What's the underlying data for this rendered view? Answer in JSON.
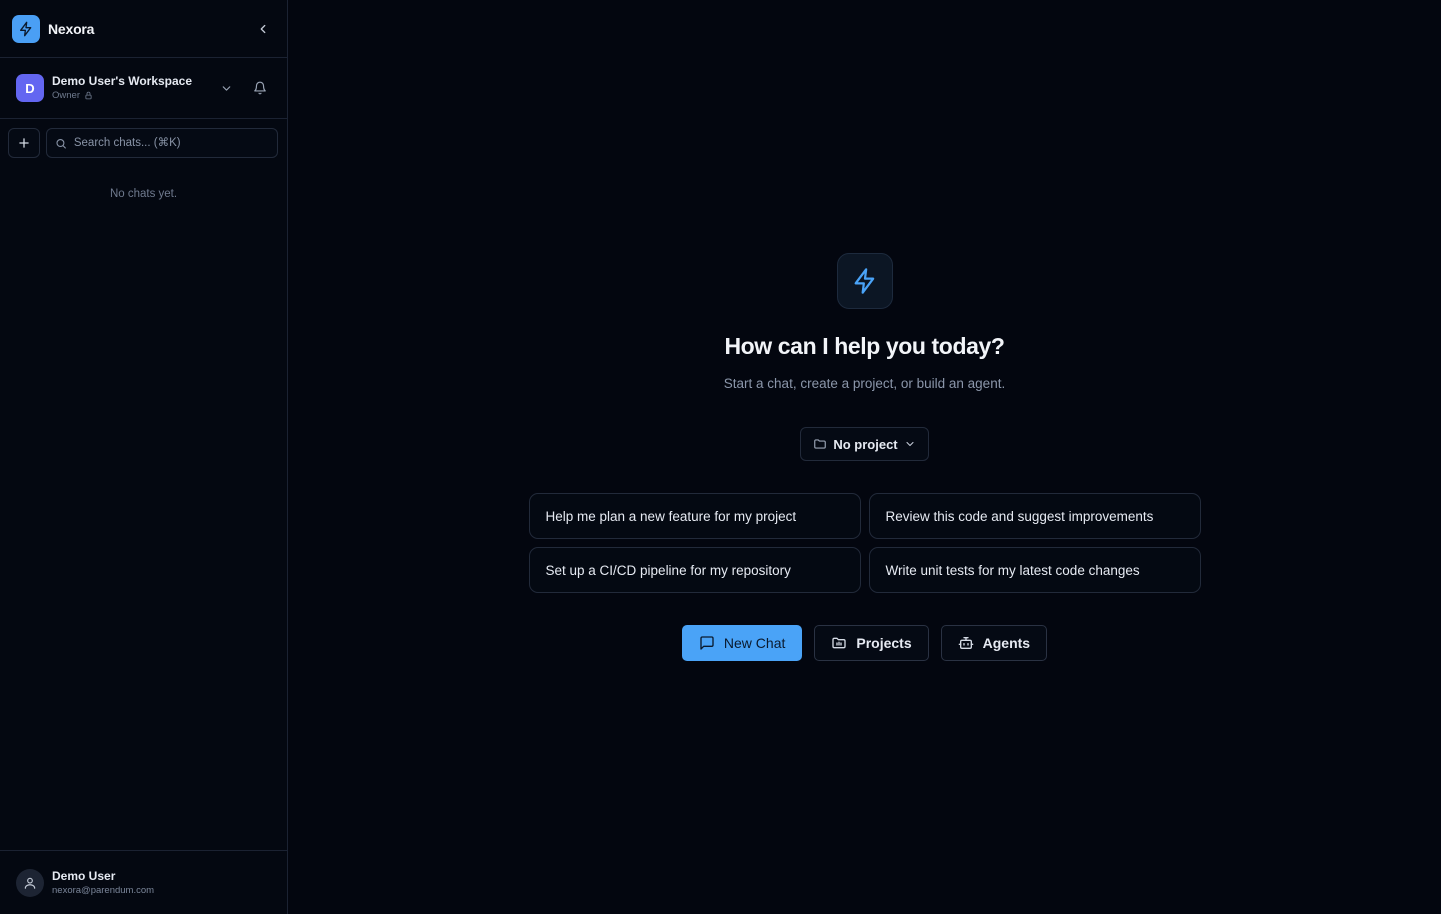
{
  "app": {
    "name": "Nexora"
  },
  "workspace": {
    "initial": "D",
    "name": "Demo User's Workspace",
    "role": "Owner"
  },
  "sidebar": {
    "search_placeholder": "Search chats... (⌘K)",
    "empty_text": "No chats yet."
  },
  "user": {
    "name": "Demo User",
    "email": "nexora@parendum.com"
  },
  "main": {
    "title": "How can I help you today?",
    "subtitle": "Start a chat, create a project, or build an agent.",
    "project_select": {
      "selected": "No project"
    },
    "suggestions": [
      "Help me plan a new feature for my project",
      "Review this code and suggest improvements",
      "Set up a CI/CD pipeline for my repository",
      "Write unit tests for my latest code changes"
    ],
    "actions": {
      "new_chat": "New Chat",
      "projects": "Projects",
      "agents": "Agents"
    }
  },
  "colors": {
    "background": "#03060f",
    "accent": "#4aa3f7",
    "workspace_avatar": "#6366f1",
    "border": "#222a3a"
  },
  "icons": {
    "logo": "lightning-bolt-icon",
    "collapse": "chevron-left-icon",
    "workspace_dropdown": "chevron-down-icon",
    "notifications": "bell-icon",
    "new_chat_small": "plus-icon",
    "search": "search-icon",
    "role_lock": "lock-icon",
    "user": "user-icon",
    "hero": "lightning-bolt-icon",
    "project_folder": "folder-icon",
    "chat": "message-square-icon",
    "agent": "bot-icon"
  }
}
